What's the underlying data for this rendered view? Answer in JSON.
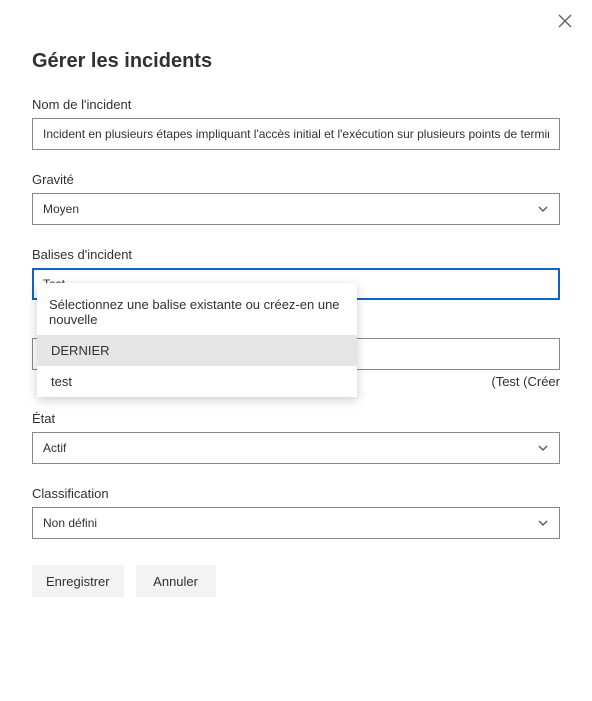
{
  "dialog": {
    "title": "Gérer les incidents",
    "close_icon": "close"
  },
  "fields": {
    "name": {
      "label": "Nom de l'incident",
      "value": "Incident en plusieurs étapes impliquant l'accès initial et l'exécution sur plusieurs points de terminaison"
    },
    "severity": {
      "label": "Gravité",
      "value": "Moyen"
    },
    "tags": {
      "label": "Balises d'incident",
      "value": "Test",
      "dropdown": {
        "header": "Sélectionnez une balise existante ou créez-en une nouvelle",
        "options": [
          {
            "label": "DERNIER",
            "selected": true
          },
          {
            "label": "test",
            "selected": false
          }
        ]
      },
      "create_hint": "(Test (Créer"
    },
    "assign": {
      "value": ""
    },
    "state": {
      "label": "État",
      "value": "Actif"
    },
    "classification": {
      "label": "Classification",
      "value": "Non défini"
    }
  },
  "buttons": {
    "save": "Enregistrer",
    "cancel": "Annuler"
  }
}
